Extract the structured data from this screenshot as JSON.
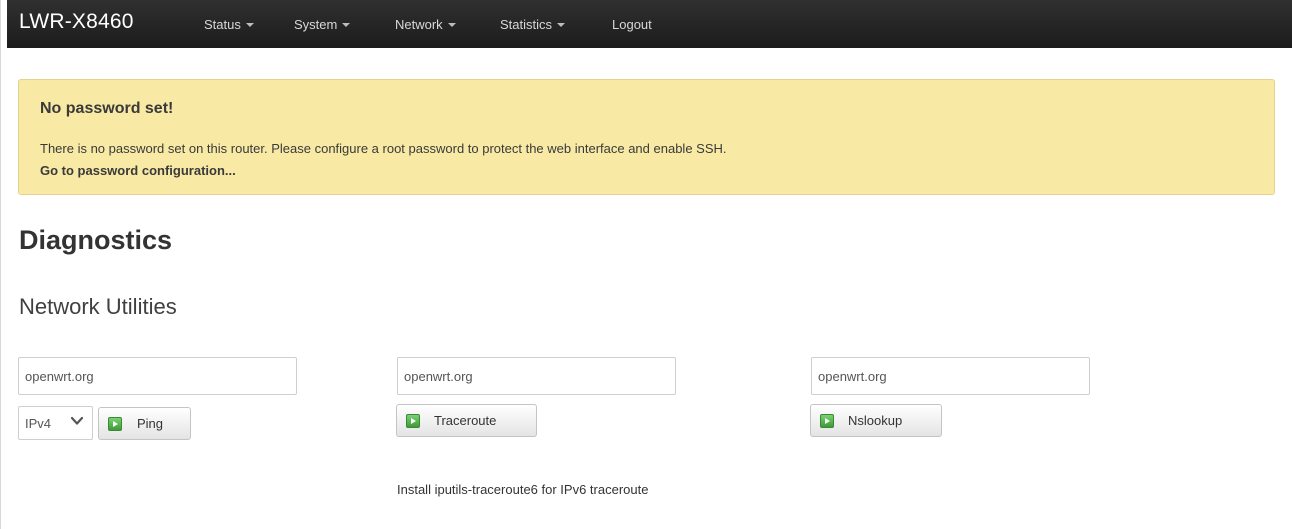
{
  "navbar": {
    "brand": "LWR-X8460",
    "items": [
      {
        "label": "Status",
        "has_dropdown": true
      },
      {
        "label": "System",
        "has_dropdown": true
      },
      {
        "label": "Network",
        "has_dropdown": true
      },
      {
        "label": "Statistics",
        "has_dropdown": true
      },
      {
        "label": "Logout",
        "has_dropdown": false
      }
    ]
  },
  "alert": {
    "title": "No password set!",
    "message": "There is no password set on this router. Please configure a root password to protect the web interface and enable SSH.",
    "link_label": "Go to password configuration..."
  },
  "page": {
    "title": "Diagnostics",
    "section_title": "Network Utilities"
  },
  "tools": {
    "ping": {
      "host_value": "openwrt.org",
      "protocol_selected": "IPv4",
      "button_label": "Ping"
    },
    "traceroute": {
      "host_value": "openwrt.org",
      "button_label": "Traceroute",
      "note": "Install iputils-traceroute6 for IPv6 traceroute"
    },
    "nslookup": {
      "host_value": "openwrt.org",
      "button_label": "Nslookup"
    }
  },
  "icons": {
    "button_icon": "play-icon",
    "select_icon": "chevron-down-icon",
    "nav_dropdown_icon": "caret-down-icon"
  },
  "colors": {
    "navbar_bg": "#222222",
    "alert_bg": "#f8e9a4",
    "alert_border": "#e7d28c",
    "button_icon": "#4caf50"
  }
}
